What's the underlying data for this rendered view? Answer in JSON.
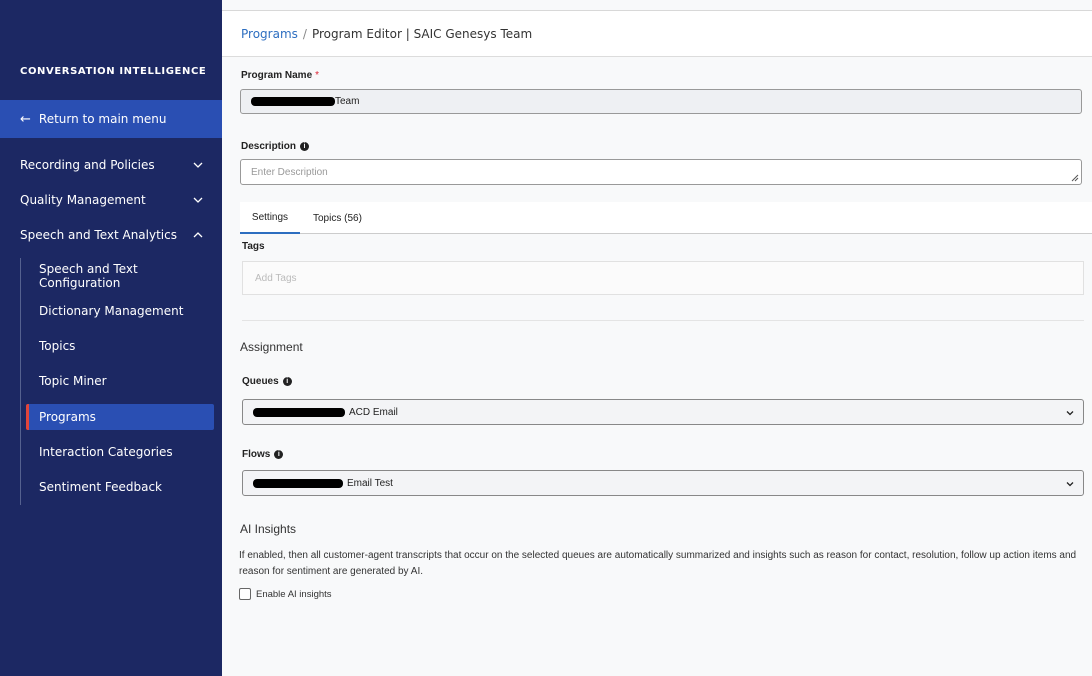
{
  "sidebar": {
    "heading": "CONVERSATION INTELLIGENCE",
    "return_label": "Return to main menu",
    "groups": [
      {
        "label": "Recording and Policies",
        "expanded": false
      },
      {
        "label": "Quality Management",
        "expanded": false
      },
      {
        "label": "Speech and Text Analytics",
        "expanded": true
      }
    ],
    "sub_items": [
      {
        "label": "Speech and Text Configuration"
      },
      {
        "label": "Dictionary Management"
      },
      {
        "label": "Topics"
      },
      {
        "label": "Topic Miner"
      },
      {
        "label": "Programs",
        "active": true
      },
      {
        "label": "Interaction Categories"
      },
      {
        "label": "Sentiment Feedback"
      }
    ],
    "colors": {
      "background": "#1c2863",
      "highlight": "#2a4fb3",
      "active_marker": "#e0453a"
    }
  },
  "breadcrumb": {
    "link": "Programs",
    "separator": "/",
    "current": "Program Editor | SAIC Genesys Team"
  },
  "form": {
    "program_name_label": "Program Name",
    "required_marker": "*",
    "program_name_value": "Team",
    "description_label": "Description",
    "description_placeholder": "Enter Description",
    "tabs": [
      {
        "label": "Settings",
        "active": true
      },
      {
        "label": "Topics (56)",
        "active": false
      }
    ],
    "tags_label": "Tags",
    "tags_placeholder": "Add Tags",
    "assignment_heading": "Assignment",
    "queues_label": "Queues",
    "queues_value": "ACD Email",
    "flows_label": "Flows",
    "flows_value": "Email Test",
    "ai_heading": "AI Insights",
    "ai_description": "If enabled, then all customer-agent transcripts that occur on the selected queues are automatically summarized and insights such as reason for contact, resolution, follow up action items and reason for sentiment are generated by AI.",
    "ai_checkbox_label": "Enable AI insights",
    "ai_checkbox_checked": false
  },
  "icons": {
    "info": "info-icon",
    "chevron": "chevron-down-icon",
    "back": "arrow-left-icon"
  },
  "accent_color": "#2d6ec0"
}
